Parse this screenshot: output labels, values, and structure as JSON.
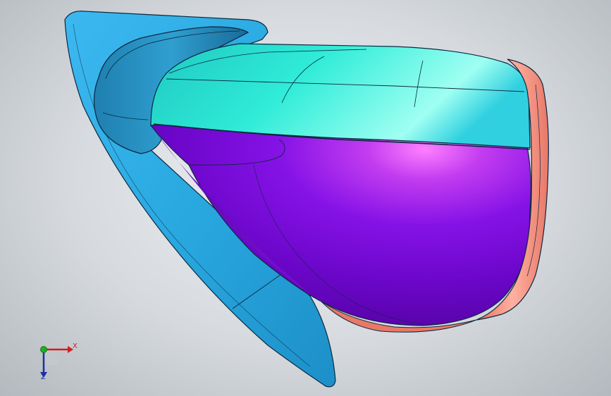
{
  "viewport": {
    "background_center": "#eef0f3",
    "background_edge": "#b4b9be"
  },
  "model": {
    "flange_color": "#29a8e0",
    "housing_top_color": "#29e8d8",
    "housing_body_color": "#8a12e8",
    "rim_color": "#f08a78",
    "edge_color": "#0b2840"
  },
  "triad": {
    "x_label": "X",
    "z_label": "Z",
    "x_color": "#d21e1e",
    "y_color": "#19b21e",
    "z_color": "#1c2fa8"
  }
}
